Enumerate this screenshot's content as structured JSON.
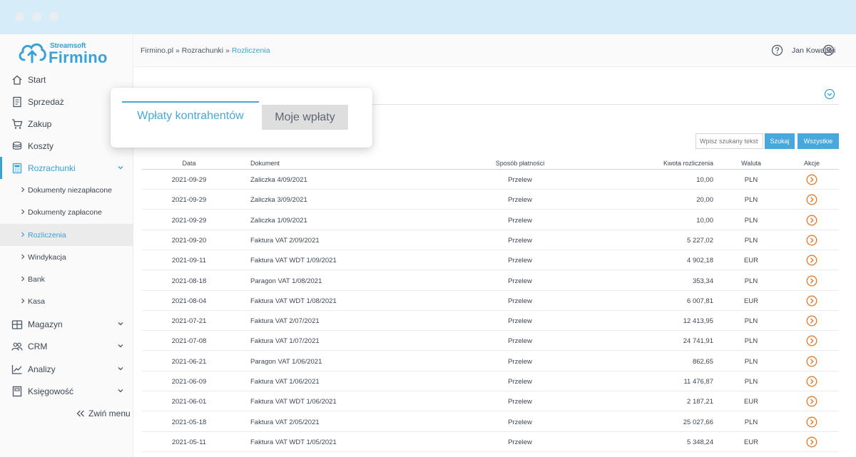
{
  "brand": {
    "small": "Streamsoft",
    "big": "Firmino"
  },
  "sidebar": {
    "items": [
      {
        "label": "Start",
        "icon": "home-icon"
      },
      {
        "label": "Sprzedaż",
        "icon": "sales-document-icon"
      },
      {
        "label": "Zakup",
        "icon": "cart-icon"
      },
      {
        "label": "Koszty",
        "icon": "coins-icon"
      },
      {
        "label": "Rozrachunki",
        "icon": "calculator-icon"
      },
      {
        "label": "Magazyn",
        "icon": "warehouse-icon"
      },
      {
        "label": "CRM",
        "icon": "users-icon"
      },
      {
        "label": "Analizy",
        "icon": "chart-icon"
      },
      {
        "label": "Księgowość",
        "icon": "book-icon"
      }
    ],
    "subitems": [
      "Dokumenty niezapłacone",
      "Dokumenty zapłacone",
      "Rozliczenia",
      "Windykacja",
      "Bank",
      "Kasa"
    ],
    "collapse_label": "Zwiń menu"
  },
  "breadcrumb": {
    "part1": "Firmino.pl",
    "sep": " » ",
    "part2": "Rozrachunki",
    "current": "Rozliczenia"
  },
  "user": {
    "name": "Jan Kowalski"
  },
  "tabs": {
    "active": "Wpłaty kontrahentów",
    "inactive": "Moje wpłaty"
  },
  "search": {
    "placeholder": "Wpisz szukany tekst",
    "search_button": "Szukaj",
    "all_button": "Wszystkie"
  },
  "table": {
    "headers": {
      "date": "Data",
      "document": "Dokument",
      "payment": "Sposób płatności",
      "amount": "Kwota rozliczenia",
      "currency": "Waluta",
      "actions": "Akcje"
    },
    "rows": [
      {
        "date": "2021-09-29",
        "document": "Zaliczka 4/09/2021",
        "payment": "Przelew",
        "amount": "10,00",
        "currency": "PLN"
      },
      {
        "date": "2021-09-29",
        "document": "Zaliczka 3/09/2021",
        "payment": "Przelew",
        "amount": "20,00",
        "currency": "PLN"
      },
      {
        "date": "2021-09-29",
        "document": "Zaliczka 1/09/2021",
        "payment": "Przelew",
        "amount": "10,00",
        "currency": "PLN"
      },
      {
        "date": "2021-09-20",
        "document": "Faktura VAT 2/09/2021",
        "payment": "Przelew",
        "amount": "5 227,02",
        "currency": "PLN"
      },
      {
        "date": "2021-09-11",
        "document": "Faktura VAT WDT 1/09/2021",
        "payment": "Przelew",
        "amount": "4 902,18",
        "currency": "EUR"
      },
      {
        "date": "2021-08-18",
        "document": "Paragon VAT 1/08/2021",
        "payment": "Przelew",
        "amount": "353,34",
        "currency": "PLN"
      },
      {
        "date": "2021-08-04",
        "document": "Faktura VAT WDT 1/08/2021",
        "payment": "Przelew",
        "amount": "6 007,81",
        "currency": "EUR"
      },
      {
        "date": "2021-07-21",
        "document": "Faktura VAT 2/07/2021",
        "payment": "Przelew",
        "amount": "12 413,95",
        "currency": "PLN"
      },
      {
        "date": "2021-07-08",
        "document": "Faktura VAT 1/07/2021",
        "payment": "Przelew",
        "amount": "24 741,91",
        "currency": "PLN"
      },
      {
        "date": "2021-06-21",
        "document": "Paragon VAT 1/06/2021",
        "payment": "Przelew",
        "amount": "862,65",
        "currency": "PLN"
      },
      {
        "date": "2021-06-09",
        "document": "Faktura VAT 1/06/2021",
        "payment": "Przelew",
        "amount": "11 476,87",
        "currency": "PLN"
      },
      {
        "date": "2021-06-01",
        "document": "Faktura VAT WDT 1/06/2021",
        "payment": "Przelew",
        "amount": "2 187,21",
        "currency": "EUR"
      },
      {
        "date": "2021-05-18",
        "document": "Faktura VAT 2/05/2021",
        "payment": "Przelew",
        "amount": "25 027,66",
        "currency": "PLN"
      },
      {
        "date": "2021-05-11",
        "document": "Faktura VAT WDT 1/05/2021",
        "payment": "Przelew",
        "amount": "5 348,24",
        "currency": "EUR"
      }
    ]
  },
  "colors": {
    "accent": "#3aa0d5",
    "button": "#48a7db",
    "action": "#e07b2a"
  }
}
